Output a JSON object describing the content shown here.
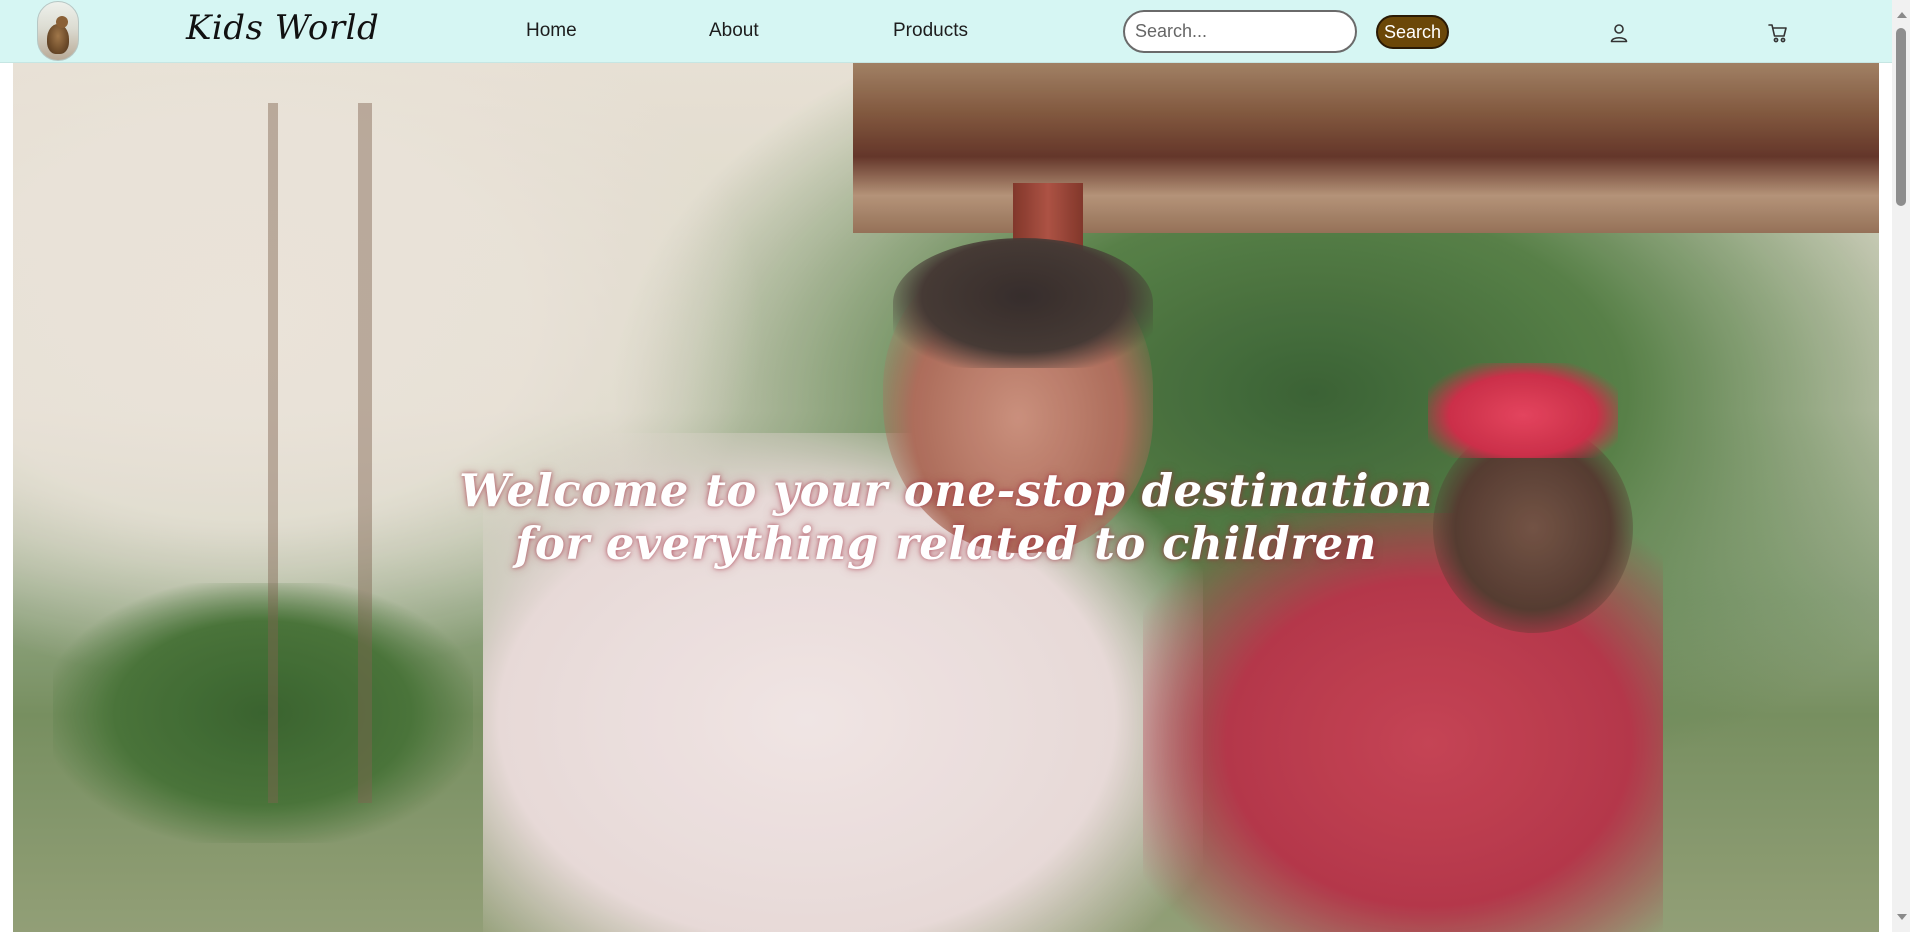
{
  "navbar": {
    "brand": "Kids World",
    "links": [
      {
        "label": "Home"
      },
      {
        "label": "About"
      },
      {
        "label": "Products"
      }
    ],
    "search": {
      "placeholder": "Search...",
      "value": "",
      "button_label": "Search"
    },
    "icons": [
      "user-icon",
      "cart-icon"
    ]
  },
  "hero": {
    "title": "Welcome to your one-stop destination for everything related to children"
  },
  "colors": {
    "navbar_bg": "#d6f6f3",
    "search_button_bg": "#6b4708",
    "hero_text": "#ffffff"
  }
}
